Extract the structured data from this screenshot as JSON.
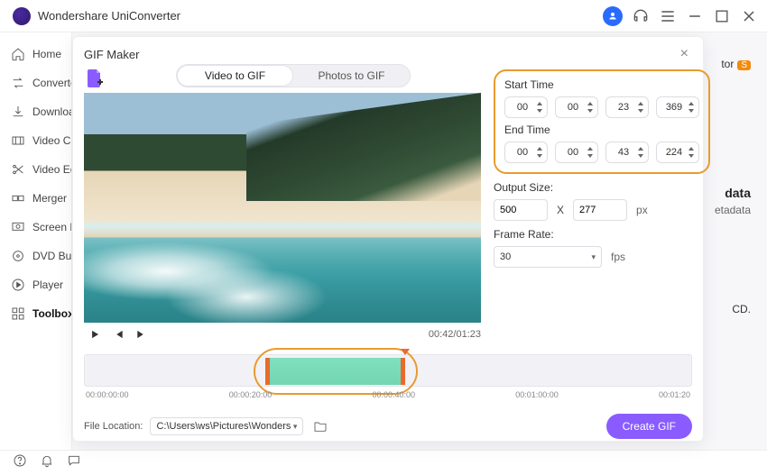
{
  "app": {
    "title": "Wondershare UniConverter"
  },
  "window": {
    "minimize": "–",
    "maximize": "□",
    "close": "×"
  },
  "sidebar": {
    "items": [
      {
        "label": "Home"
      },
      {
        "label": "Converter"
      },
      {
        "label": "Downloader"
      },
      {
        "label": "Video Compressor"
      },
      {
        "label": "Video Editor"
      },
      {
        "label": "Merger"
      },
      {
        "label": "Screen Recorder"
      },
      {
        "label": "DVD Burner"
      },
      {
        "label": "Player"
      },
      {
        "label": "Toolbox"
      }
    ]
  },
  "backdrop": {
    "tor_label": "tor",
    "data_label": "data",
    "metadata_label": "etadata",
    "cd_label": "CD."
  },
  "modal": {
    "title": "GIF Maker",
    "tabs": {
      "video": "Video to GIF",
      "photos": "Photos to GIF"
    },
    "playback": {
      "current": "00:42",
      "duration": "01:23",
      "combined": "00:42/01:23"
    },
    "start_label": "Start Time",
    "end_label": "End Time",
    "start": {
      "h": "00",
      "m": "00",
      "s": "23",
      "ms": "369"
    },
    "end": {
      "h": "00",
      "m": "00",
      "s": "43",
      "ms": "224"
    },
    "output_size_label": "Output Size:",
    "output": {
      "w": "500",
      "h": "277",
      "unit": "px",
      "sep": "X"
    },
    "frame_rate_label": "Frame Rate:",
    "frame_rate_value": "30",
    "frame_rate_unit": "fps",
    "timeline": {
      "ticks": [
        "00:00:00:00",
        "00:00:20:00",
        "00:00:40:00",
        "00:01:00:00",
        "00:01:20"
      ]
    },
    "file_location_label": "File Location:",
    "file_location_value": "C:\\Users\\ws\\Pictures\\Wonders",
    "create_label": "Create GIF"
  }
}
